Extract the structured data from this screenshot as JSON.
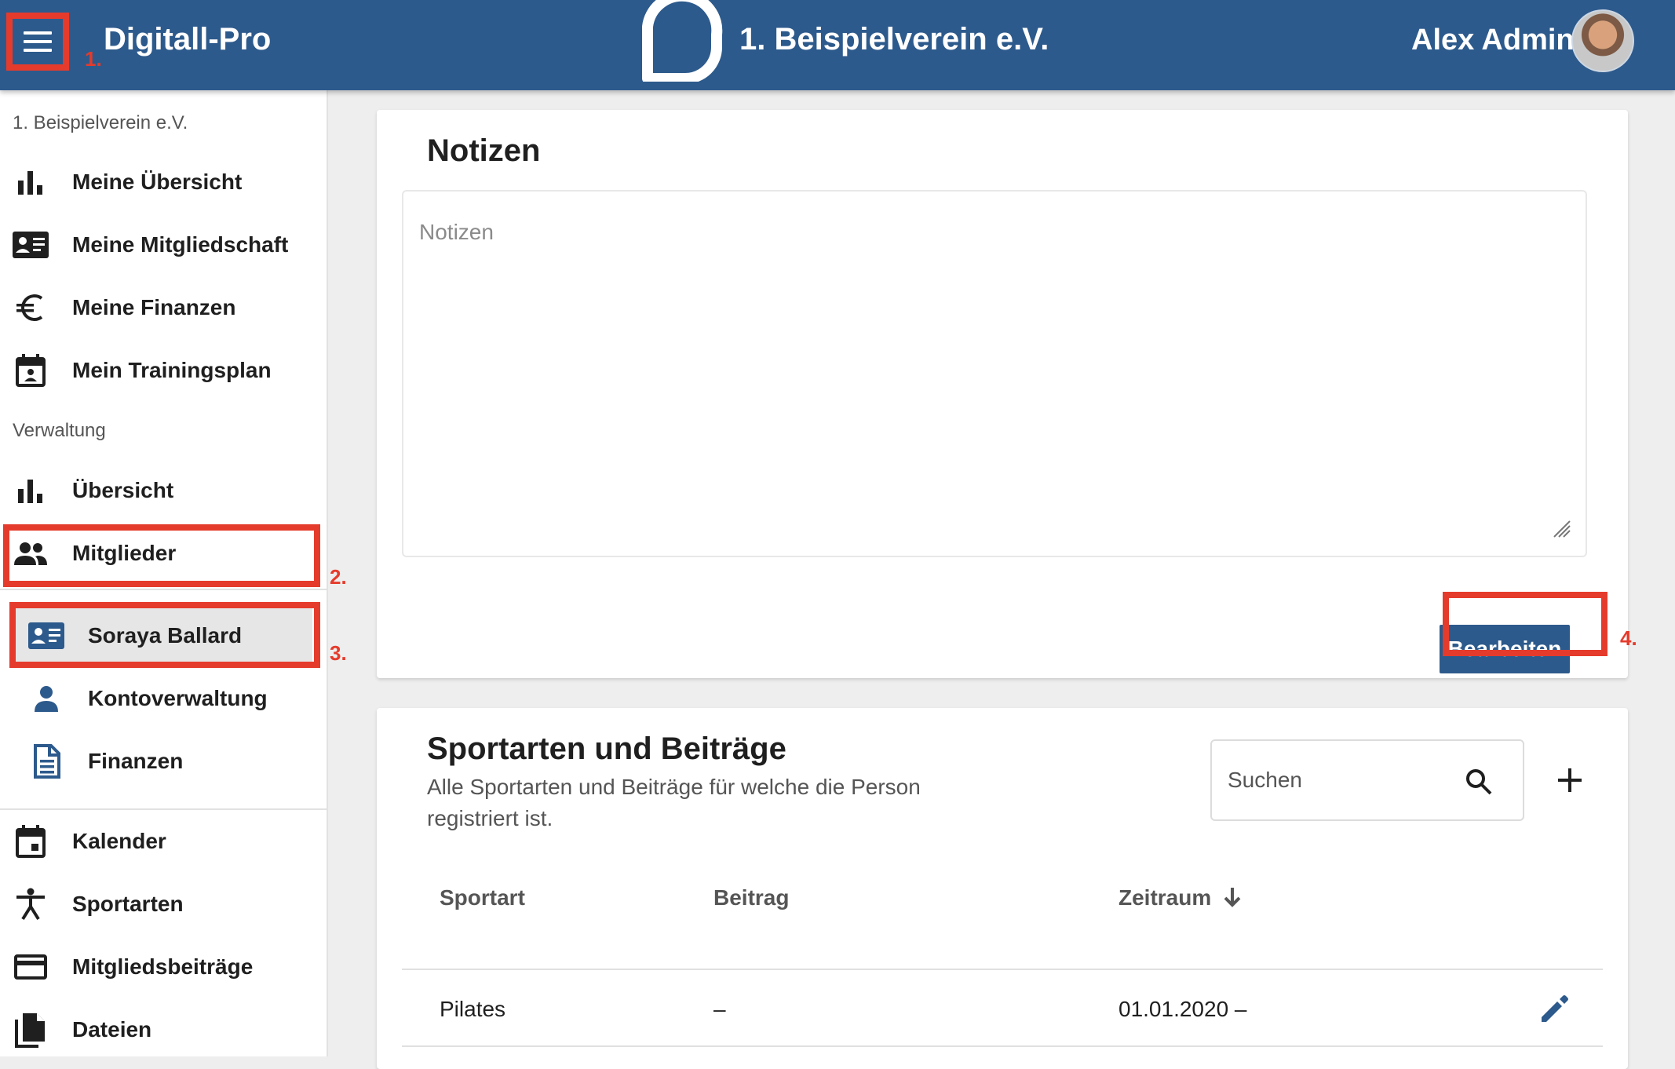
{
  "colors": {
    "primary": "#2d5a8c",
    "highlight": "#e53b2c"
  },
  "header": {
    "app_title": "Digitall-Pro",
    "club_title": "1. Beispielverein e.V.",
    "user_name": "Alex Admin",
    "menu_icon": "hamburger-menu-icon",
    "logo_icon": "digitall-logo-icon"
  },
  "annotations": {
    "a1": "1.",
    "a2": "2.",
    "a3": "3.",
    "a4": "4."
  },
  "sidebar": {
    "club_section": "1. Beispielverein e.V.",
    "admin_section": "Verwaltung",
    "items": [
      {
        "label": "Meine Übersicht",
        "icon": "bar-chart-icon"
      },
      {
        "label": "Meine Mitgliedschaft",
        "icon": "member-card-icon"
      },
      {
        "label": "Meine Finanzen",
        "icon": "euro-icon"
      },
      {
        "label": "Mein Trainingsplan",
        "icon": "calendar-person-icon"
      },
      {
        "label": "Übersicht",
        "icon": "bar-chart-icon"
      },
      {
        "label": "Mitglieder",
        "icon": "people-icon"
      },
      {
        "label": "Soraya Ballard",
        "icon": "member-card-icon"
      },
      {
        "label": "Kontoverwaltung",
        "icon": "person-icon"
      },
      {
        "label": "Finanzen",
        "icon": "document-icon"
      },
      {
        "label": "Kalender",
        "icon": "calendar-icon"
      },
      {
        "label": "Sportarten",
        "icon": "sport-icon"
      },
      {
        "label": "Mitgliedsbeiträge",
        "icon": "credit-card-icon"
      },
      {
        "label": "Dateien",
        "icon": "files-icon"
      }
    ]
  },
  "notes_card": {
    "title": "Notizen",
    "textarea_placeholder": "Notizen",
    "edit_label": "Bearbeiten"
  },
  "sports_card": {
    "title": "Sportarten und Beiträge",
    "subtitle_line1": "Alle Sportarten und Beiträge für welche die Person",
    "subtitle_line2": "registriert ist.",
    "search_placeholder": "Suchen",
    "columns": [
      "Sportart",
      "Beitrag",
      "Zeitraum"
    ],
    "rows": [
      {
        "sport": "Pilates",
        "fee": "–",
        "period": "01.01.2020 –"
      }
    ]
  }
}
